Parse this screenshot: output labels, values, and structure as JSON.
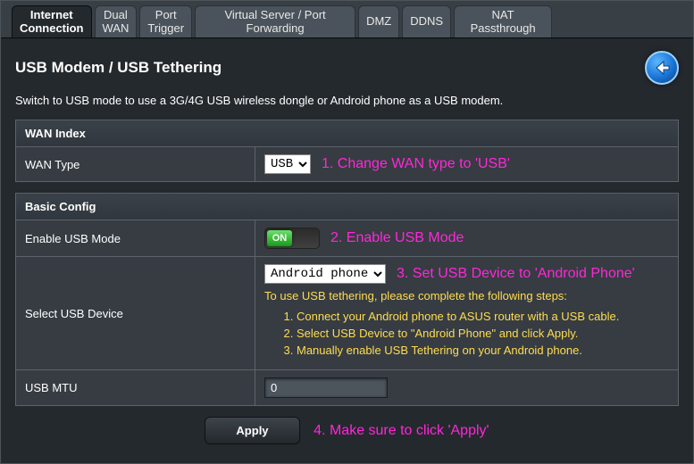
{
  "tabs": {
    "t0": "Internet\nConnection",
    "t1": "Dual\nWAN",
    "t2": "Port\nTrigger",
    "t3": "Virtual Server / Port\nForwarding",
    "t4": "DMZ",
    "t5": "DDNS",
    "t6": "NAT\nPassthrough"
  },
  "page_title": "USB Modem / USB Tethering",
  "description": "Switch to USB mode to use a 3G/4G USB wireless dongle or Android phone as a USB modem.",
  "wan_index": {
    "header": "WAN Index",
    "wan_type_label": "WAN Type",
    "wan_type_value": "USB",
    "annot": "1. Change WAN type to 'USB'"
  },
  "basic": {
    "header": "Basic Config",
    "enable_label": "Enable USB Mode",
    "toggle_text": "ON",
    "enable_annot": "2. Enable USB Mode",
    "device_label": "Select USB Device",
    "device_value": "Android phone",
    "device_annot": "3. Set USB Device to 'Android Phone'",
    "tether_hint": "To use USB tethering, please complete the following steps:",
    "step1": "Connect your Android phone to ASUS router with a USB cable.",
    "step2": "Select USB Device to \"Android Phone\" and click Apply.",
    "step3": "Manually enable USB Tethering on your Android phone.",
    "mtu_label": "USB MTU",
    "mtu_value": "0"
  },
  "apply_label": "Apply",
  "apply_annot": "4. Make sure to click 'Apply'"
}
